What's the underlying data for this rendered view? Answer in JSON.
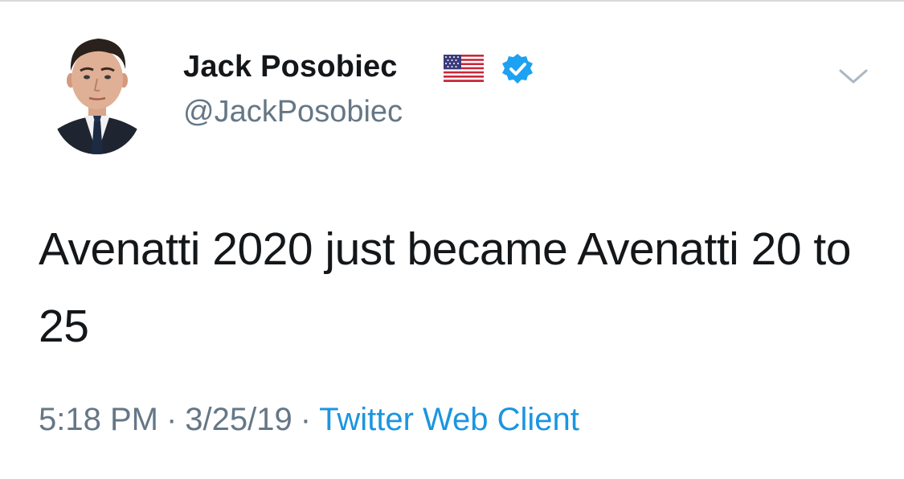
{
  "author": {
    "display_name": "Jack Posobiec",
    "handle": "@JackPosobiec",
    "flag_icon": "us-flag-icon",
    "verified_icon": "verified-badge-icon",
    "verified_color": "#1da1f2"
  },
  "tweet": {
    "text": "Avenatti 2020 just became Avenatti 20 to 25"
  },
  "meta": {
    "time": "5:18 PM",
    "separator": "·",
    "date": "3/25/19",
    "client": "Twitter Web Client",
    "client_color": "#1b95e0"
  },
  "controls": {
    "menu_icon": "chevron-down-icon"
  }
}
